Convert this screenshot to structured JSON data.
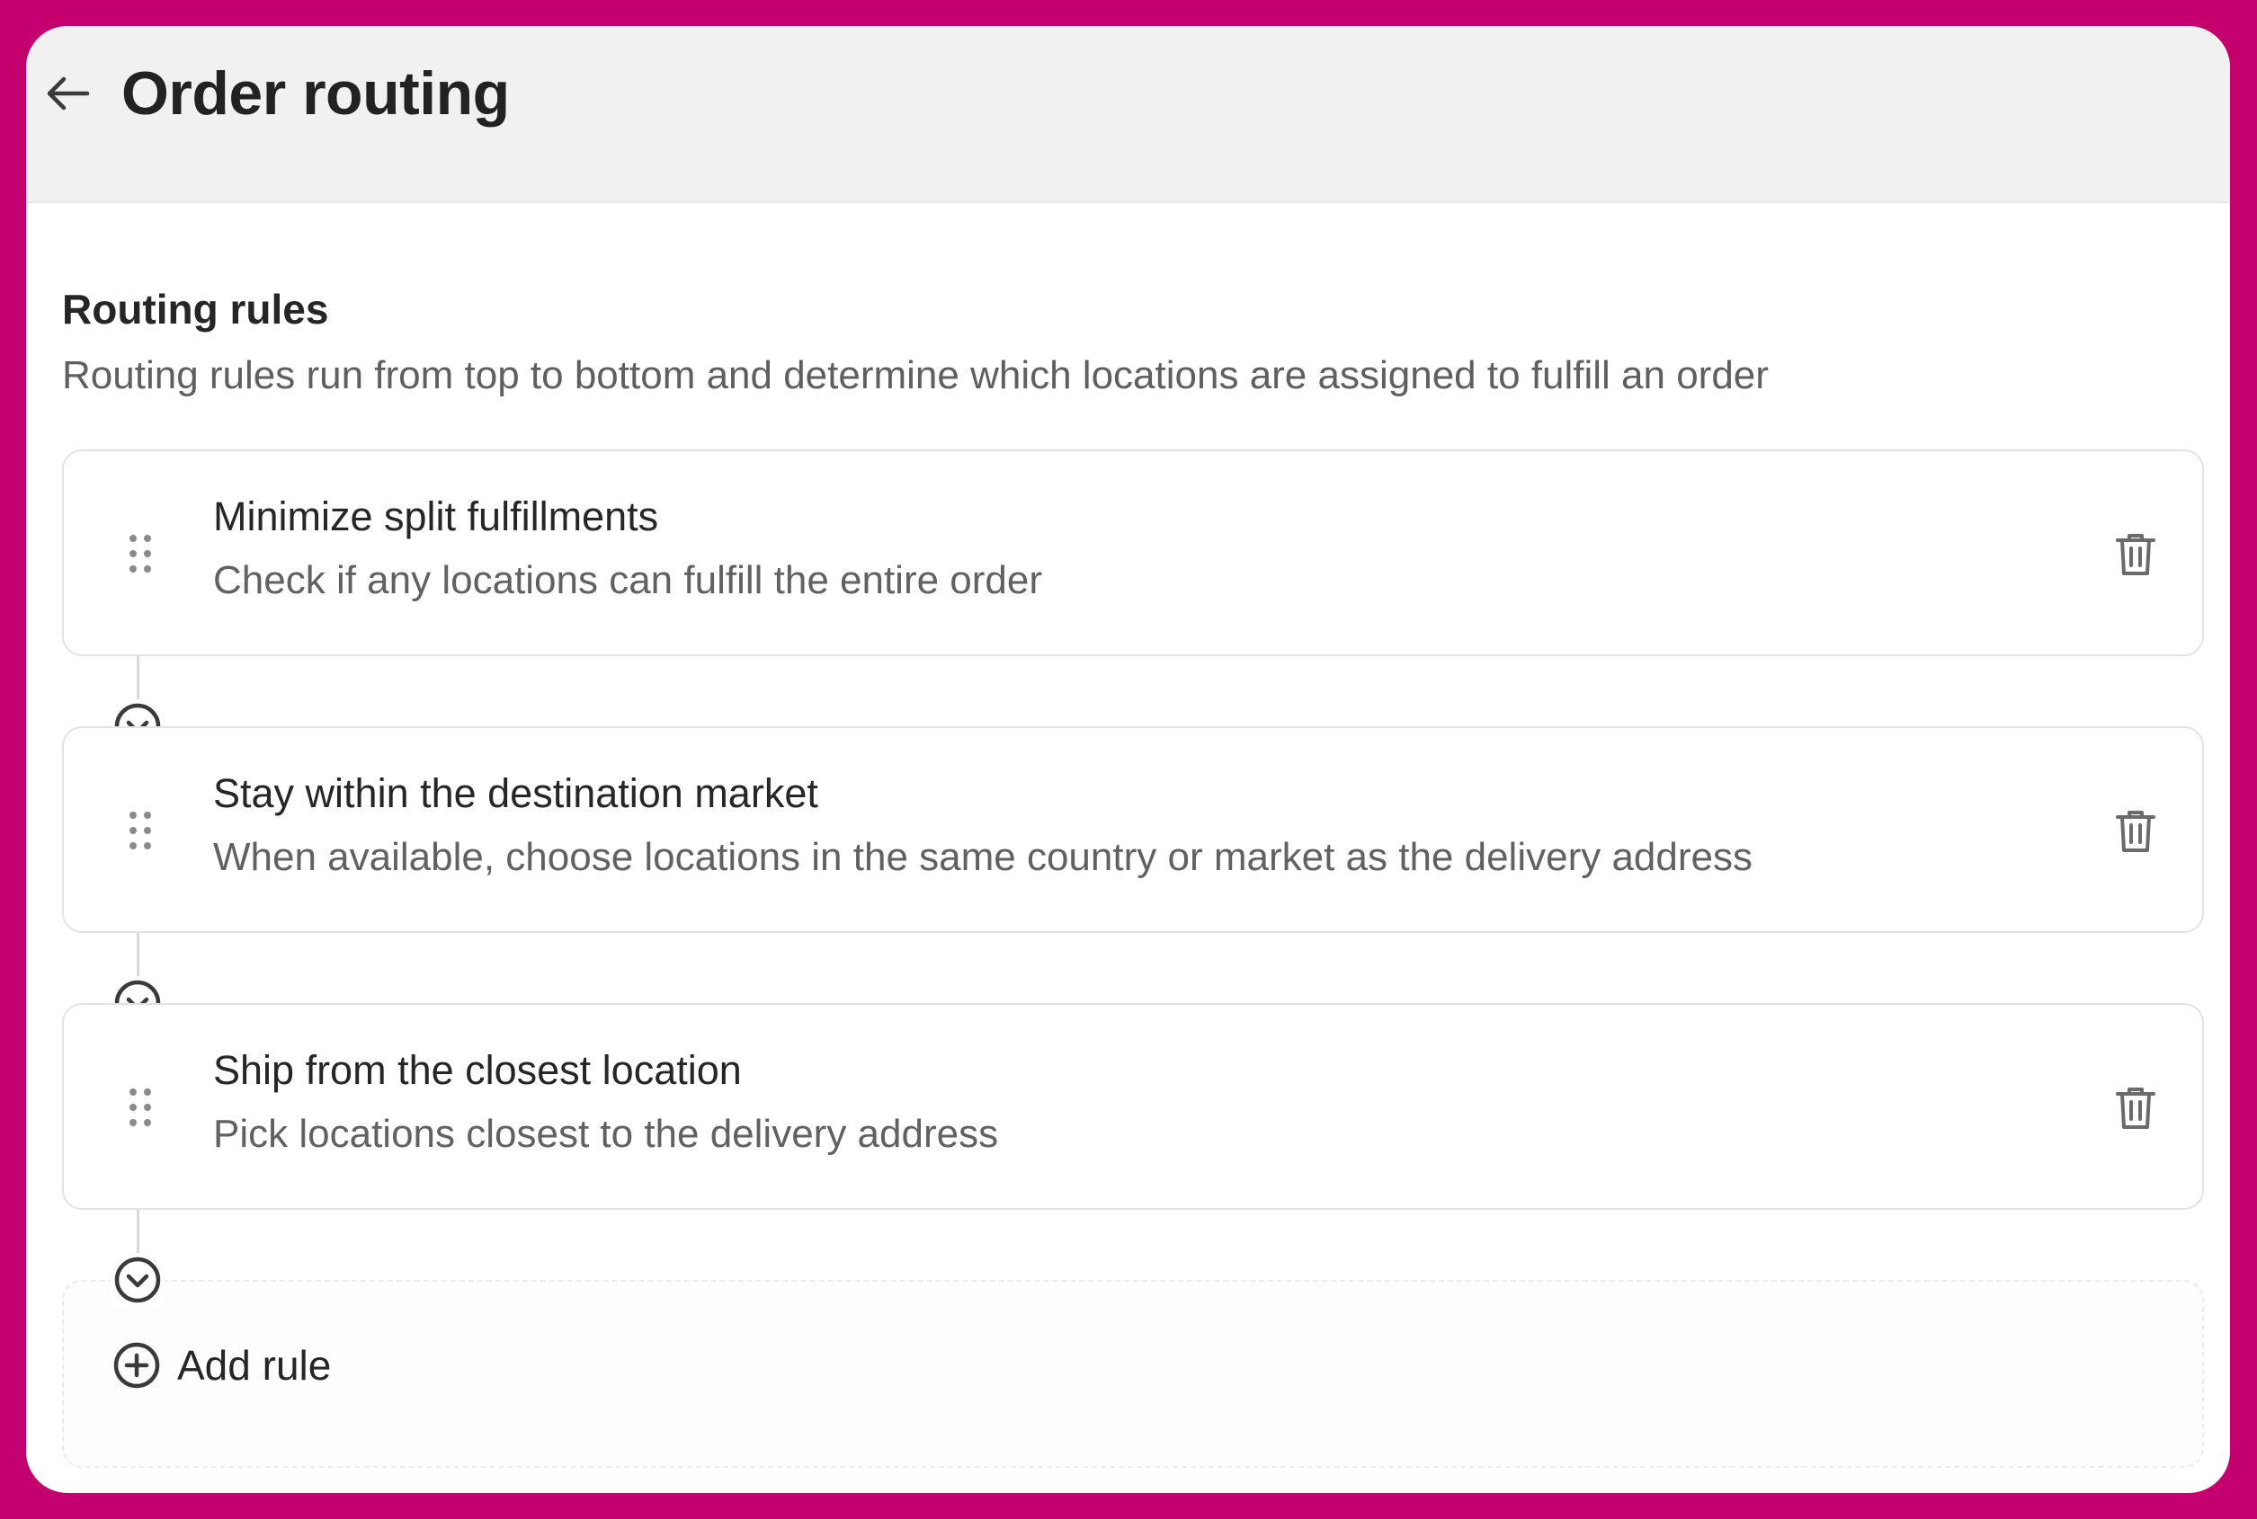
{
  "header": {
    "title": "Order routing",
    "back_icon": "arrow-left-icon"
  },
  "section": {
    "title": "Routing rules",
    "description": "Routing rules run from top to bottom and determine which locations are assigned to fulfill an order"
  },
  "rules": [
    {
      "name": "Minimize split fulfillments",
      "description": "Check if any locations can fulfill the entire order"
    },
    {
      "name": "Stay within the destination market",
      "description": "When available, choose locations in the same country or market as the delivery address"
    },
    {
      "name": "Ship from the closest location",
      "description": "Pick locations closest to the delivery address"
    }
  ],
  "add_rule": {
    "label": "Add rule",
    "icon": "plus-circle-icon"
  },
  "colors": {
    "frame": "#c4006e",
    "header_bg": "#f1f1f1",
    "text_primary": "#262626",
    "text_secondary": "#616161"
  }
}
